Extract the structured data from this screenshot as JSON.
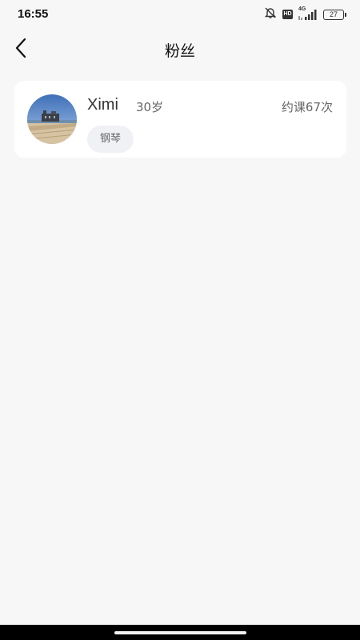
{
  "status_bar": {
    "time": "16:55",
    "network": "4G",
    "hd": "HD",
    "battery": "27",
    "icons": [
      "notifications-off-icon",
      "hd-icon",
      "signal-icon",
      "battery-icon"
    ]
  },
  "header": {
    "title": "粉丝",
    "back_icon": "chevron-left-icon"
  },
  "fans": [
    {
      "name": "Ximi",
      "age": "30岁",
      "booking_count": "约课67次",
      "tag": "钢琴",
      "avatar": "avatar-photo"
    }
  ],
  "colors": {
    "background": "#f7f7f7",
    "card": "#ffffff",
    "tag_bg": "#f0f1f5",
    "secondary_text": "#666666"
  }
}
